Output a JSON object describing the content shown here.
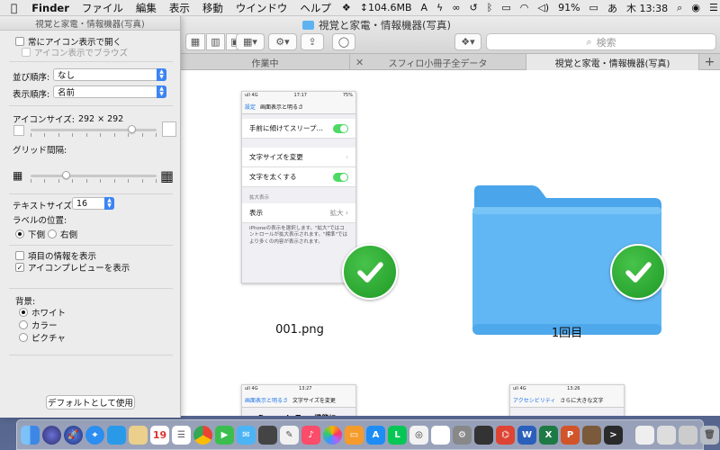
{
  "menubar": {
    "apple": "",
    "app": "Finder",
    "menus": [
      "ファイル",
      "編集",
      "表示",
      "移動",
      "ウインドウ",
      "ヘルプ"
    ],
    "net_speed": "↕104.6MB",
    "battery": "91%",
    "input_mode": "あ",
    "clock": "木 13:38"
  },
  "window": {
    "title": "視覚と家電・情報機器(写真)",
    "search_placeholder": "検索",
    "tabs": [
      {
        "label": "作業中"
      },
      {
        "label": "スフィロ小冊子全データ"
      },
      {
        "label": "視覚と家電・情報機器(写真)"
      }
    ],
    "tab_add": "+",
    "items": [
      {
        "label": "001.png"
      },
      {
        "label": "1回目"
      }
    ]
  },
  "thumb1": {
    "status_left": "ull 4G",
    "status_time": "17:17",
    "status_right": "75%",
    "back": "設定",
    "title": "画面表示と明るさ",
    "rows": [
      "手前に傾けてスリープ…",
      "文字サイズを変更",
      "文字を太くする"
    ],
    "section": "拡大表示",
    "display_label": "表示",
    "display_value": "拡大",
    "footer": "iPhoneの表示を選択します。\"拡大\"ではコントロールが拡大表示されます。\"標準\"ではより多くの内容が表示されます。"
  },
  "thumb2": {
    "time": "13:27",
    "back": "画面表示と明るさ",
    "title": "文字サイズを変更",
    "body": "Dynamic Type機能に対応"
  },
  "thumb3": {
    "time": "13:26",
    "back": "アクセシビリティ",
    "title": "さらに大きな文字"
  },
  "panel": {
    "title": "視覚と家電・情報機器(写真)",
    "always_open_icon": "常にアイコン表示で開く",
    "browse_icon": "アイコン表示でブラウズ",
    "arrange_label": "並び順序:",
    "arrange_value": "なし",
    "sort_label": "表示順序:",
    "sort_value": "名前",
    "icon_size_label": "アイコンサイズ:",
    "icon_size_value": "292 × 292",
    "icon_size_fraction": 0.8,
    "grid_label": "グリッド間隔:",
    "grid_fraction": 0.28,
    "text_size_label": "テキストサイズ:",
    "text_size_value": "16",
    "label_pos_label": "ラベルの位置:",
    "label_pos_bottom": "下側",
    "label_pos_right": "右側",
    "show_item_info": "項目の情報を表示",
    "show_icon_preview": "アイコンプレビューを表示",
    "background_label": "背景:",
    "bg_white": "ホワイト",
    "bg_color": "カラー",
    "bg_picture": "ピクチャ",
    "default_button": "デフォルトとして使用"
  },
  "colors": {
    "accent": "#3b84f4",
    "check": "#2aa830",
    "folder": "#61b7f3"
  },
  "dock": {
    "calendar_day": "19"
  }
}
